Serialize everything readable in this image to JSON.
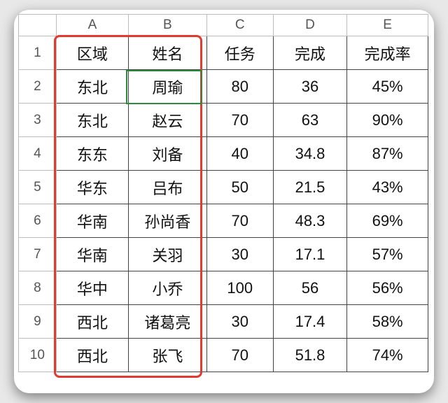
{
  "columns": [
    "A",
    "B",
    "C",
    "D",
    "E"
  ],
  "row_numbers": [
    "1",
    "2",
    "3",
    "4",
    "5",
    "6",
    "7",
    "8",
    "9",
    "10"
  ],
  "headers": {
    "A": "区域",
    "B": "姓名",
    "C": "任务",
    "D": "完成",
    "E": "完成率"
  },
  "rows": [
    {
      "A": "东北",
      "B": "周瑜",
      "C": "80",
      "D": "36",
      "E": "45%"
    },
    {
      "A": "东北",
      "B": "赵云",
      "C": "70",
      "D": "63",
      "E": "90%"
    },
    {
      "A": "东东",
      "B": "刘备",
      "C": "40",
      "D": "34.8",
      "E": "87%"
    },
    {
      "A": "华东",
      "B": "吕布",
      "C": "50",
      "D": "21.5",
      "E": "43%"
    },
    {
      "A": "华南",
      "B": "孙尚香",
      "C": "70",
      "D": "48.3",
      "E": "69%"
    },
    {
      "A": "华南",
      "B": "关羽",
      "C": "30",
      "D": "17.1",
      "E": "57%"
    },
    {
      "A": "华中",
      "B": "小乔",
      "C": "100",
      "D": "56",
      "E": "56%"
    },
    {
      "A": "西北",
      "B": "诸葛亮",
      "C": "30",
      "D": "17.4",
      "E": "58%"
    },
    {
      "A": "西北",
      "B": "张飞",
      "C": "70",
      "D": "51.8",
      "E": "74%"
    }
  ],
  "selection_range": "A1:B10",
  "active_cell": "B2",
  "chart_data": {
    "type": "table",
    "title": "",
    "columns": [
      "区域",
      "姓名",
      "任务",
      "完成",
      "完成率"
    ],
    "records": [
      [
        "东北",
        "周瑜",
        80,
        36,
        "45%"
      ],
      [
        "东北",
        "赵云",
        70,
        63,
        "90%"
      ],
      [
        "东东",
        "刘备",
        40,
        34.8,
        "87%"
      ],
      [
        "华东",
        "吕布",
        50,
        21.5,
        "43%"
      ],
      [
        "华南",
        "孙尚香",
        70,
        48.3,
        "69%"
      ],
      [
        "华南",
        "关羽",
        30,
        17.1,
        "57%"
      ],
      [
        "华中",
        "小乔",
        100,
        56,
        "56%"
      ],
      [
        "西北",
        "诸葛亮",
        30,
        17.4,
        "58%"
      ],
      [
        "西北",
        "张飞",
        70,
        51.8,
        "74%"
      ]
    ]
  }
}
